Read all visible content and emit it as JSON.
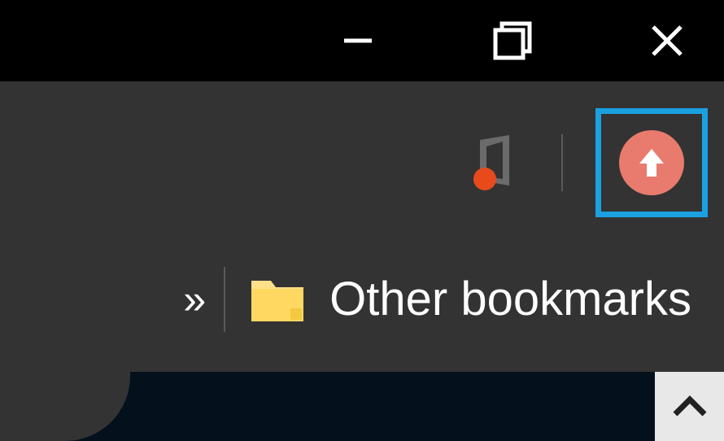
{
  "titlebar": {
    "minimize": "minimize",
    "maximize": "maximize",
    "close": "close"
  },
  "toolbar": {
    "extension_name": "office-extension",
    "upload_name": "upload-button"
  },
  "bookmarksbar": {
    "overflow_label": "»",
    "other_label": "Other bookmarks"
  }
}
